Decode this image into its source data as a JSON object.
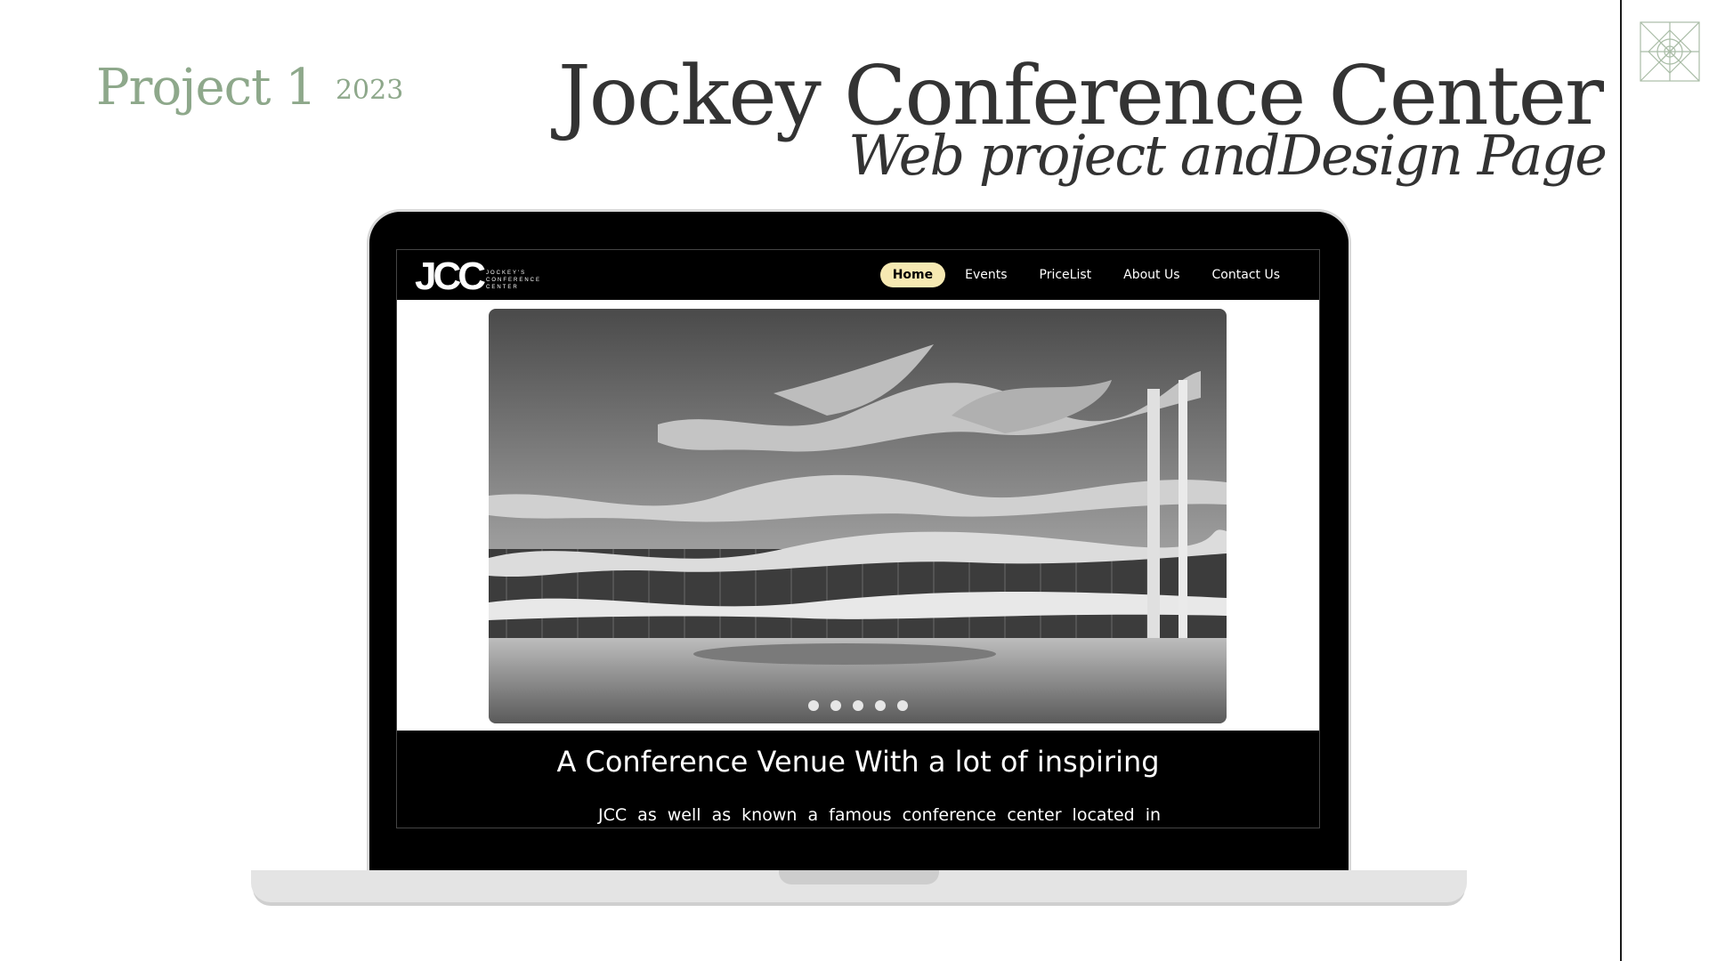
{
  "header": {
    "project_label": "Project 1",
    "year": "2023",
    "title": "Jockey Conference Center",
    "subtitle": "Web project andDesign Page"
  },
  "site": {
    "logo_text": "JCC",
    "logo_subtext": "JOCKEY'S CONFERENCE CENTER",
    "nav": [
      {
        "label": "Home",
        "active": true
      },
      {
        "label": "Events",
        "active": false
      },
      {
        "label": "PriceList",
        "active": false
      },
      {
        "label": "About Us",
        "active": false
      },
      {
        "label": "Contact Us",
        "active": false
      }
    ],
    "hero": {
      "image": "black-and-white modern wavy-floor conference building",
      "slide_count": 5
    },
    "headline": "A Conference Venue With a lot of inspiring",
    "body_text": "JCC as well as known a famous conference center located in"
  },
  "colors": {
    "accent_green": "#8ea88b",
    "active_pill": "#f6e9b2",
    "title_text": "#333333"
  },
  "icons": {
    "ornament": "geometric-ornament-icon"
  }
}
